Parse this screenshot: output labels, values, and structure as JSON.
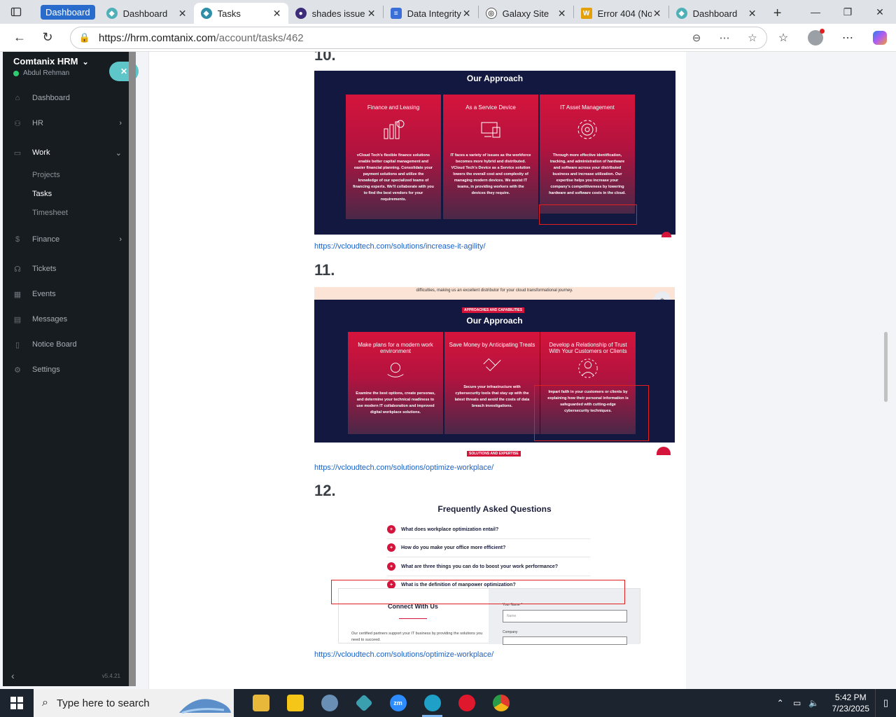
{
  "browser": {
    "tab_group_label": "Dashboard",
    "tabs": [
      {
        "label": "Dashboard",
        "icon": "comtanix-icon",
        "color": "#4fb0b8"
      },
      {
        "label": "Tasks",
        "icon": "comtanix-icon",
        "color": "#2f8fa8",
        "active": true
      },
      {
        "label": "shades issue",
        "icon": "github-icon",
        "color": "#3d2c7a"
      },
      {
        "label": "Data Integrity",
        "icon": "forms-icon",
        "color": "#3a6fd8"
      },
      {
        "label": "Galaxy Site",
        "icon": "globe-icon",
        "color": "#555555"
      },
      {
        "label": "Error 404 (No",
        "icon": "w-icon",
        "color": "#e3a008"
      },
      {
        "label": "Dashboard",
        "icon": "comtanix-icon",
        "color": "#4fb0b8"
      }
    ],
    "url_host": "https://hrm.comtanix.com",
    "url_path": "/account/tasks/462"
  },
  "sidebar": {
    "brand": "Comtanix HRM",
    "user": "Abdul Rehman",
    "items": [
      {
        "label": "Dashboard",
        "icon": "house-icon"
      },
      {
        "label": "HR",
        "icon": "people-icon"
      },
      {
        "label": "Work",
        "icon": "briefcase-icon"
      },
      {
        "label": "Finance",
        "icon": "dollar-icon"
      },
      {
        "label": "Tickets",
        "icon": "headset-icon"
      },
      {
        "label": "Events",
        "icon": "calendar-icon"
      },
      {
        "label": "Messages",
        "icon": "chat-icon"
      },
      {
        "label": "Notice Board",
        "icon": "clipboard-icon"
      },
      {
        "label": "Settings",
        "icon": "gear-icon"
      }
    ],
    "work_sub": [
      "Projects",
      "Tasks",
      "Timesheet"
    ],
    "version": "v5.4.21"
  },
  "content": {
    "item10_number": "10.",
    "item11_number": "11.",
    "item12_number": "12.",
    "shot1": {
      "heading": "Our Approach",
      "cards": [
        {
          "title": "Finance and Leasing",
          "text": "vCloud Tech's flexible finance solutions enable better capital management and easier financial planning. Consolidate your payment solutions and utilize the knowledge of our specialized teams of financing experts. We'll collaborate with you to find the best vendors for your requirements."
        },
        {
          "title": "As a Service Device",
          "text": "IT faces a variety of issues as the workforce becomes more hybrid and distributed. VCloud Tech's Device as a Service solution lowers the overall cost and complexity of managing modern devices. We assist IT teams, in providing workers with the devices they require."
        },
        {
          "title": "IT Asset Management",
          "text": "Through more effective identification, tracking, and administration of hardware and software across your distributed business and increase utilization. Our expertise helps you increase your company's competitiveness by lowering hardware and software costs in the cloud."
        }
      ]
    },
    "link1": "https://vcloudtech.com/solutions/increase-it-agility/",
    "shot2": {
      "top_text": "difficulties, making us an excellent distributor for your cloud transformational journey.",
      "tag": "APPROACHES AND CAPABILITIES",
      "heading": "Our Approach",
      "bottom_tag": "SOLUTIONS AND EXPERTISE",
      "cards": [
        {
          "title": "Make plans for a modern work environment",
          "text": "Examine the best options, create personas, and determine your technical readiness to use modern IT collaboration and improved digital workplace solutions."
        },
        {
          "title": "Save Money by Anticipating Treats",
          "text": "Secure your infrastructure with cybersecurity tools that stay up with the latest threats and avoid the costs of data breach investigations."
        },
        {
          "title": "Develop a Relationship of Trust With Your Customers or Clients",
          "text": "Impart faith in your customers or clients by explaining how their personal information is safeguarded with cutting-edge cybersecurity techniques."
        }
      ]
    },
    "link2": "https://vcloudtech.com/solutions/optimize-workplace/",
    "faq": {
      "title": "Frequently Asked Questions",
      "questions": [
        "What does workplace optimization entail?",
        "How do you make your office more efficient?",
        "What are three things you can do to boost your work performance?",
        "What is the definition of manpower optimization?"
      ],
      "connect_title": "Connect With Us",
      "connect_text": "Our certified partners support your IT business by providing the solutions you need to succeed.",
      "name_label": "Your Name *",
      "name_placeholder": "Name",
      "company_label": "Company"
    },
    "link3": "https://vcloudtech.com/solutions/optimize-workplace/"
  },
  "taskbar": {
    "search_placeholder": "Type here to search",
    "apps": [
      {
        "name": "file-explorer-icon",
        "color": "#e8b83a"
      },
      {
        "name": "sticky-notes-icon",
        "color": "#f5c518"
      },
      {
        "name": "rider-app-icon",
        "color": "#6a8fb5"
      },
      {
        "name": "comtanix-app-icon",
        "color": "#3aa0b0"
      },
      {
        "name": "zoom-icon",
        "color": "#2d8cff"
      },
      {
        "name": "edge-icon",
        "color": "#1fa0c7"
      },
      {
        "name": "opera-icon",
        "color": "#e0182d"
      },
      {
        "name": "chrome-icon",
        "color": "#e8ba2a"
      }
    ],
    "time": "5:42 PM",
    "date": "7/23/2025"
  }
}
